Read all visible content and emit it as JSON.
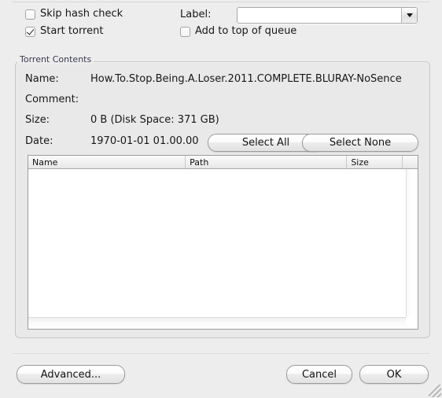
{
  "options": {
    "skip_hash_check": {
      "label": "Skip hash check",
      "checked": false
    },
    "start_torrent": {
      "label": "Start torrent",
      "checked": true
    },
    "add_to_top_of_queue": {
      "label": "Add to top of queue",
      "checked": false
    },
    "label_field": {
      "label": "Label:",
      "value": "",
      "placeholder": ""
    }
  },
  "torrent_contents": {
    "group_title": "Torrent Contents",
    "info": [
      {
        "key": "Name:",
        "value": "How.To.Stop.Being.A.Loser.2011.COMPLETE.BLURAY-NoSence"
      },
      {
        "key": "Comment:",
        "value": ""
      },
      {
        "key": "Size:",
        "value": "0 B (Disk Space: 371 GB)"
      },
      {
        "key": "Date:",
        "value": "1970-01-01 01.00.00"
      }
    ],
    "select_all_label": "Select All",
    "select_none_label": "Select None",
    "table": {
      "columns": [
        "Name",
        "Path",
        "Size",
        ""
      ],
      "rows": []
    }
  },
  "footer": {
    "advanced_label": "Advanced...",
    "cancel_label": "Cancel",
    "ok_label": "OK"
  },
  "colors": {
    "window_bg": "#ededed",
    "group_bg": "#e9e9e9",
    "table_bg": "#ffffff",
    "group_title_text": "#3a3a52",
    "border": "#c6c6c6"
  }
}
